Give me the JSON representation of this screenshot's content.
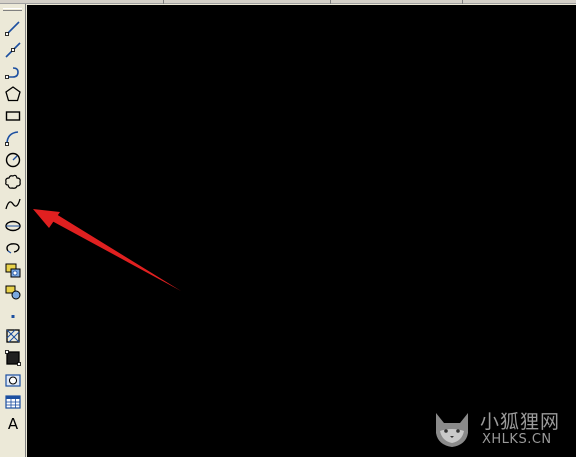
{
  "toolbar": {
    "tools": [
      {
        "name": "line-tool",
        "icon": "line-icon"
      },
      {
        "name": "construction-line-tool",
        "icon": "construction-line-icon"
      },
      {
        "name": "polyline-tool",
        "icon": "polyline-icon"
      },
      {
        "name": "polygon-tool",
        "icon": "polygon-icon"
      },
      {
        "name": "rectangle-tool",
        "icon": "rectangle-icon"
      },
      {
        "name": "arc-tool",
        "icon": "arc-icon"
      },
      {
        "name": "circle-tool",
        "icon": "circle-icon"
      },
      {
        "name": "revision-cloud-tool",
        "icon": "revision-cloud-icon"
      },
      {
        "name": "spline-tool",
        "icon": "spline-icon"
      },
      {
        "name": "ellipse-tool",
        "icon": "ellipse-icon"
      },
      {
        "name": "ellipse-arc-tool",
        "icon": "ellipse-arc-icon"
      },
      {
        "name": "insert-block-tool",
        "icon": "insert-block-icon"
      },
      {
        "name": "make-block-tool",
        "icon": "make-block-icon"
      },
      {
        "name": "point-tool",
        "icon": "point-icon"
      },
      {
        "name": "hatch-tool",
        "icon": "hatch-icon"
      },
      {
        "name": "gradient-tool",
        "icon": "gradient-icon"
      },
      {
        "name": "region-tool",
        "icon": "region-icon"
      },
      {
        "name": "table-tool",
        "icon": "table-icon"
      },
      {
        "name": "multiline-text-tool",
        "icon": "text-icon",
        "label": "A"
      }
    ]
  },
  "canvas": {
    "background": "#000000"
  },
  "annotation": {
    "color": "#e02020",
    "points_to": "spline-tool"
  },
  "watermark": {
    "cn_text": "小狐狸网",
    "en_text": "XHLKS.CN",
    "color": "#9a9a9a"
  },
  "colors": {
    "toolbar_bg": "#ece9d8",
    "icon_blue": "#1c4fa0"
  }
}
